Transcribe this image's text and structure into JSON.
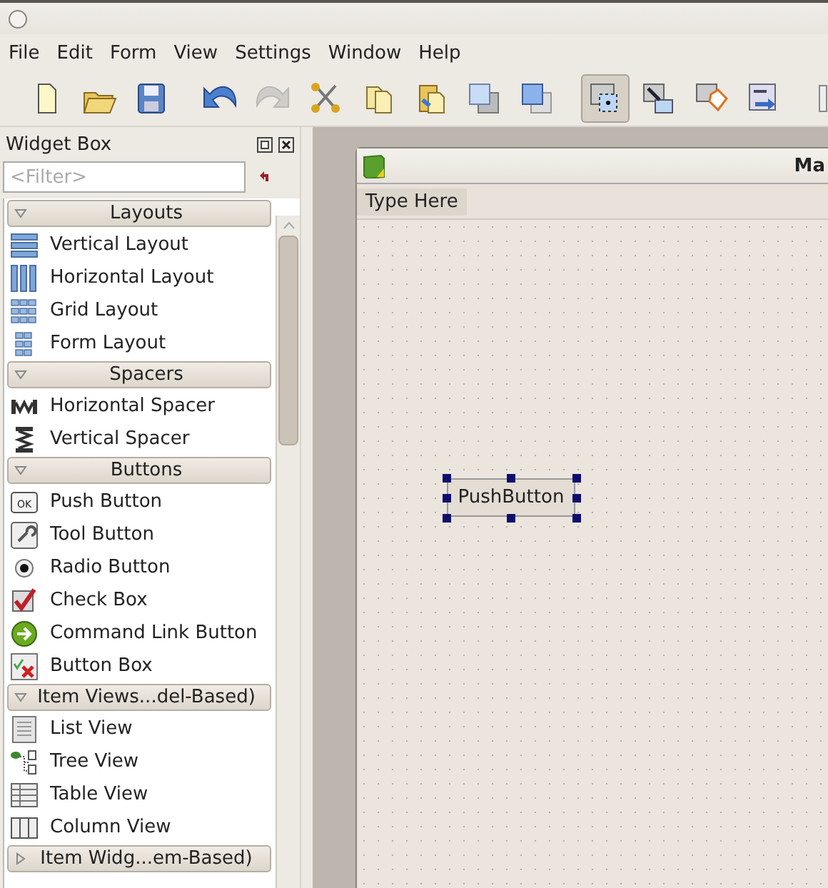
{
  "window": {
    "show_title_dot": true
  },
  "menu": [
    "File",
    "Edit",
    "Form",
    "View",
    "Settings",
    "Window",
    "Help"
  ],
  "toolbar": {
    "groups": [
      [
        {
          "kind": "new",
          "selected": false,
          "disabled": false
        },
        {
          "kind": "open",
          "selected": false,
          "disabled": false
        },
        {
          "kind": "save",
          "selected": false,
          "disabled": false
        }
      ],
      [
        {
          "kind": "undo",
          "selected": false,
          "disabled": false
        },
        {
          "kind": "redo",
          "selected": false,
          "disabled": true
        },
        {
          "kind": "cut",
          "selected": false,
          "disabled": false
        },
        {
          "kind": "copy",
          "selected": false,
          "disabled": false
        },
        {
          "kind": "paste",
          "selected": false,
          "disabled": false
        },
        {
          "kind": "raise",
          "selected": false,
          "disabled": false
        },
        {
          "kind": "lower",
          "selected": false,
          "disabled": false
        }
      ],
      [
        {
          "kind": "edit-widgets",
          "selected": true,
          "disabled": false
        },
        {
          "kind": "edit-signals",
          "selected": false,
          "disabled": false
        },
        {
          "kind": "edit-buddies",
          "selected": false,
          "disabled": false
        },
        {
          "kind": "edit-tab-order",
          "selected": false,
          "disabled": false
        }
      ],
      [
        {
          "kind": "layout-horizontal",
          "selected": false,
          "disabled": false
        }
      ]
    ]
  },
  "widget_box": {
    "title": "Widget Box",
    "filter": {
      "placeholder": "<Filter>"
    },
    "categories": [
      {
        "title": "Layouts",
        "expanded": true,
        "items": [
          {
            "label": "Vertical Layout",
            "kind": "vertical-layout"
          },
          {
            "label": "Horizontal Layout",
            "kind": "horizontal-layout"
          },
          {
            "label": "Grid Layout",
            "kind": "grid-layout"
          },
          {
            "label": "Form Layout",
            "kind": "form-layout"
          }
        ]
      },
      {
        "title": "Spacers",
        "expanded": true,
        "items": [
          {
            "label": "Horizontal Spacer",
            "kind": "horizontal-spacer"
          },
          {
            "label": "Vertical Spacer",
            "kind": "vertical-spacer"
          }
        ]
      },
      {
        "title": "Buttons",
        "expanded": true,
        "items": [
          {
            "label": "Push Button",
            "kind": "push-button",
            "icon_text": "OK"
          },
          {
            "label": "Tool Button",
            "kind": "tool-button"
          },
          {
            "label": "Radio Button",
            "kind": "radio-button"
          },
          {
            "label": "Check Box",
            "kind": "check-box"
          },
          {
            "label": "Command Link Button",
            "kind": "command-link"
          },
          {
            "label": "Button Box",
            "kind": "button-box"
          }
        ]
      },
      {
        "title": "Item Views...del-Based)",
        "expanded": true,
        "items": [
          {
            "label": "List View",
            "kind": "list-view"
          },
          {
            "label": "Tree View",
            "kind": "tree-view"
          },
          {
            "label": "Table View",
            "kind": "table-view"
          },
          {
            "label": "Column View",
            "kind": "column-view"
          }
        ]
      },
      {
        "title": "Item Widg...em-Based)",
        "expanded": false
      }
    ]
  },
  "form": {
    "title": "Ma",
    "menu_placeholder": "Type Here",
    "push_button": {
      "label": "PushButton",
      "selected": true
    }
  }
}
